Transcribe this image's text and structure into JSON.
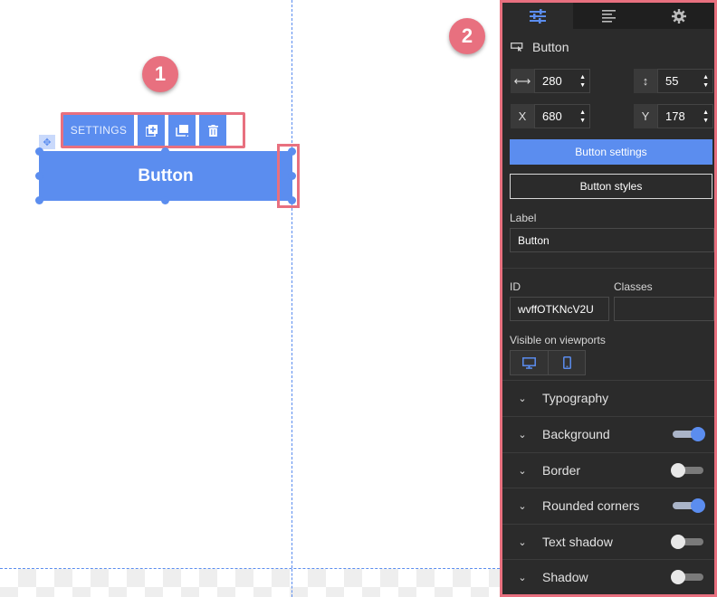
{
  "callouts": {
    "one": "1",
    "two": "2"
  },
  "canvas": {
    "toolbar": {
      "settings_label": "SETTINGS",
      "icons": [
        "add-element-icon",
        "duplicate-icon",
        "trash-icon"
      ]
    },
    "button_label": "Button"
  },
  "panel": {
    "tabs": [
      {
        "icon": "sliders-icon",
        "active": true
      },
      {
        "icon": "text-align-icon",
        "active": false
      },
      {
        "icon": "gear-icon",
        "active": false
      }
    ],
    "element_title": "Button",
    "width": "280",
    "height": "55",
    "x_label": "X",
    "x": "680",
    "y_label": "Y",
    "y": "178",
    "settings_button": "Button settings",
    "styles_button": "Button styles",
    "label_field": {
      "label": "Label",
      "value": "Button"
    },
    "id_field": {
      "label": "ID",
      "value": "wvffOTKNcV2U"
    },
    "classes_field": {
      "label": "Classes",
      "value": ""
    },
    "viewports": {
      "label": "Visible on viewports",
      "options": [
        "desktop-icon",
        "mobile-icon"
      ]
    },
    "sections": [
      {
        "label": "Typography"
      },
      {
        "label": "Background",
        "toggle": true
      },
      {
        "label": "Border",
        "toggle": false
      },
      {
        "label": "Rounded corners",
        "toggle": true
      },
      {
        "label": "Text shadow",
        "toggle": false
      },
      {
        "label": "Shadow",
        "toggle": false
      }
    ]
  },
  "colors": {
    "accent": "#5b8def",
    "highlight": "#e8707f",
    "panel_bg": "#2b2b2b"
  }
}
